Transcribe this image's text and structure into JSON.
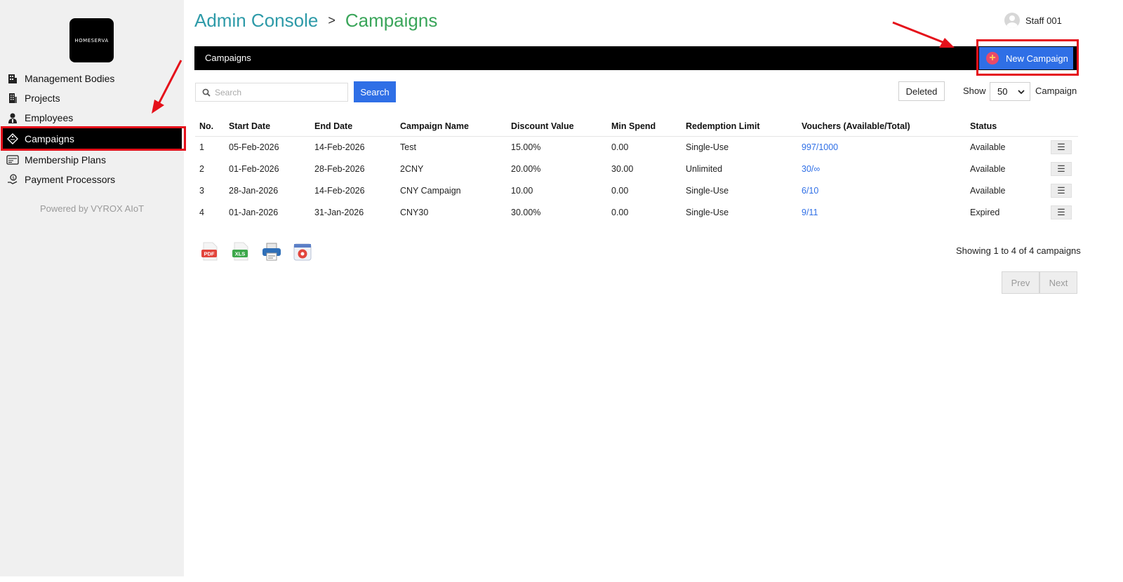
{
  "brand": {
    "logo_text": "HOMESERVA"
  },
  "sidebar": {
    "items": [
      {
        "label": "Management Bodies",
        "icon": "building-icon"
      },
      {
        "label": "Projects",
        "icon": "office-icon"
      },
      {
        "label": "Employees",
        "icon": "employee-icon"
      },
      {
        "label": "Campaigns",
        "icon": "tag-icon",
        "active": true
      },
      {
        "label": "Membership Plans",
        "icon": "card-icon"
      },
      {
        "label": "Payment Processors",
        "icon": "payment-icon"
      }
    ],
    "powered_by": "Powered by VYROX AIoT"
  },
  "breadcrumb": {
    "root": "Admin Console",
    "separator": ">",
    "current": "Campaigns"
  },
  "user": {
    "name": "Staff 001"
  },
  "section_bar": {
    "title": "Campaigns",
    "new_button": "New Campaign"
  },
  "toolbar": {
    "search_placeholder": "Search",
    "search_button": "Search",
    "deleted_button": "Deleted",
    "show_label": "Show",
    "show_value": "50",
    "show_suffix": "Campaign"
  },
  "table": {
    "headers": [
      "No.",
      "Start Date",
      "End Date",
      "Campaign Name",
      "Discount Value",
      "Min Spend",
      "Redemption Limit",
      "Vouchers (Available/Total)",
      "Status"
    ],
    "rows": [
      {
        "no": "1",
        "start": "05-Feb-2026",
        "end": "14-Feb-2026",
        "name": "Test",
        "discount": "15.00%",
        "min_spend": "0.00",
        "limit": "Single-Use",
        "vouchers": "997/1000",
        "status": "Available"
      },
      {
        "no": "2",
        "start": "01-Feb-2026",
        "end": "28-Feb-2026",
        "name": "2CNY",
        "discount": "20.00%",
        "min_spend": "30.00",
        "limit": "Unlimited",
        "vouchers": "30/∞",
        "status": "Available"
      },
      {
        "no": "3",
        "start": "28-Jan-2026",
        "end": "14-Feb-2026",
        "name": "CNY Campaign",
        "discount": "10.00",
        "min_spend": "0.00",
        "limit": "Single-Use",
        "vouchers": "6/10",
        "status": "Available"
      },
      {
        "no": "4",
        "start": "01-Jan-2026",
        "end": "31-Jan-2026",
        "name": "CNY30",
        "discount": "30.00%",
        "min_spend": "0.00",
        "limit": "Single-Use",
        "vouchers": "9/11",
        "status": "Expired"
      }
    ]
  },
  "exports": {
    "pdf": "PDF",
    "xls": "XLS"
  },
  "pagination": {
    "summary": "Showing 1 to 4 of 4 campaigns",
    "prev": "Prev",
    "next": "Next"
  },
  "colors": {
    "accent": "#2f6fe6",
    "title_teal": "#2d9aa8",
    "title_green": "#3aa55a",
    "annotation_red": "#e5101a"
  }
}
